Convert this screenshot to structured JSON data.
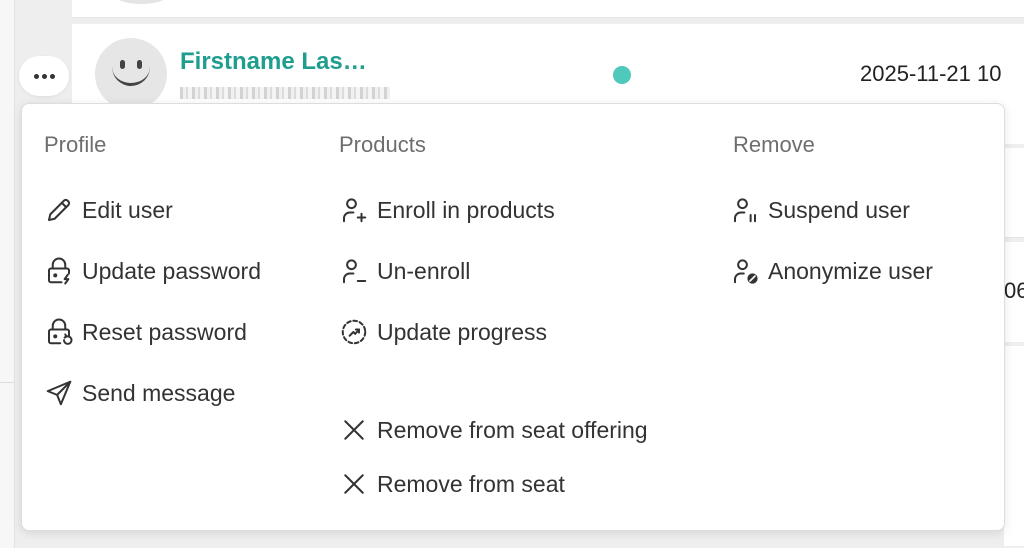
{
  "row": {
    "user_name": "Firstname Las…",
    "date": "2025-11-21 10",
    "peek_text": "06",
    "status_color": "#4ec9bc",
    "name_color": "#1f9e8f"
  },
  "menu": {
    "profile": {
      "heading": "Profile",
      "items": [
        {
          "label": "Edit user",
          "icon": "pencil-icon"
        },
        {
          "label": "Update password",
          "icon": "lock-lightning-icon"
        },
        {
          "label": "Reset password",
          "icon": "lock-reset-icon"
        },
        {
          "label": "Send message",
          "icon": "send-icon"
        }
      ]
    },
    "products": {
      "heading": "Products",
      "items": [
        {
          "label": "Enroll in products",
          "icon": "user-plus-icon"
        },
        {
          "label": "Un-enroll",
          "icon": "user-minus-icon"
        },
        {
          "label": "Update progress",
          "icon": "progress-icon"
        },
        {
          "label": "Remove from seat offering",
          "icon": "x-icon"
        },
        {
          "label": "Remove from seat",
          "icon": "x-icon"
        }
      ]
    },
    "remove": {
      "heading": "Remove",
      "items": [
        {
          "label": "Suspend user",
          "icon": "user-pause-icon"
        },
        {
          "label": "Anonymize user",
          "icon": "user-blocked-icon"
        }
      ]
    }
  }
}
